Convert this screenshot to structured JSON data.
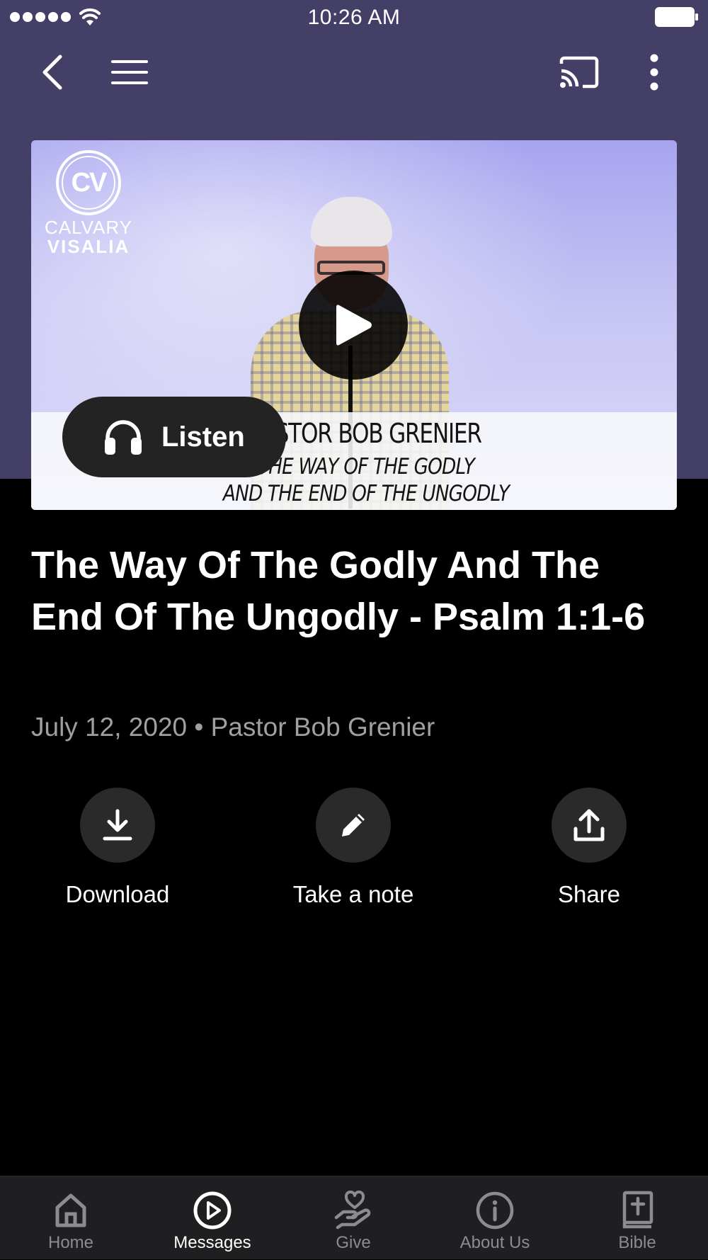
{
  "status_bar": {
    "time": "10:26 AM",
    "icons": [
      "signal-dots-icon",
      "wifi-icon",
      "battery-icon"
    ]
  },
  "nav_bar": {
    "icons": [
      "back-icon",
      "menu-icon",
      "cast-icon",
      "more-vertical-icon"
    ]
  },
  "media": {
    "logo": {
      "monogram": "CV",
      "line1": "CALVARY",
      "line2": "VISALIA"
    },
    "lower_third": {
      "name": "PASTOR BOB GRENIER",
      "title_line1": "THE WAY OF THE GODLY",
      "title_line2": "AND THE END OF THE UNGODLY"
    },
    "listen_label": "Listen"
  },
  "message": {
    "title": "The Way Of The Godly And The End Of The Ungodly - Psalm 1:1-6",
    "meta": "July 12, 2020 • Pastor Bob Grenier"
  },
  "actions": [
    {
      "label": "Download",
      "icon": "download-icon"
    },
    {
      "label": "Take a note",
      "icon": "pencil-icon"
    },
    {
      "label": "Share",
      "icon": "share-icon"
    }
  ],
  "tabs": [
    {
      "label": "Home",
      "icon": "home-icon",
      "active": false
    },
    {
      "label": "Messages",
      "icon": "play-circle-icon",
      "active": true
    },
    {
      "label": "Give",
      "icon": "give-icon",
      "active": false
    },
    {
      "label": "About Us",
      "icon": "info-icon",
      "active": false
    },
    {
      "label": "Bible",
      "icon": "bible-icon",
      "active": false
    }
  ],
  "colors": {
    "header": "#433f67",
    "background": "#000000",
    "tab_bar": "#1f1f22",
    "action_circle": "#2a2a2a",
    "muted_text": "#a0a0a0"
  }
}
